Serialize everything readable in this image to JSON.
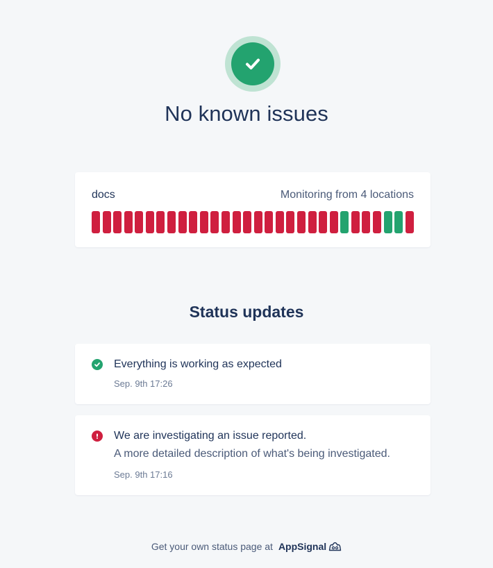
{
  "colors": {
    "up": "#23a36f",
    "down": "#cf1f3f",
    "halo": "#bfe3d3"
  },
  "status": {
    "icon": "check-icon",
    "headline": "No known issues"
  },
  "monitor": {
    "name": "docs",
    "locations_text": "Monitoring from 4 locations",
    "bars": [
      "down",
      "down",
      "down",
      "down",
      "down",
      "down",
      "down",
      "down",
      "down",
      "down",
      "down",
      "down",
      "down",
      "down",
      "down",
      "down",
      "down",
      "down",
      "down",
      "down",
      "down",
      "down",
      "down",
      "up",
      "down",
      "down",
      "down",
      "up",
      "up",
      "down"
    ]
  },
  "updates": {
    "title": "Status updates",
    "items": [
      {
        "icon": "check-circle-icon",
        "title": "Everything is working as expected",
        "description": "",
        "time": "Sep. 9th 17:26"
      },
      {
        "icon": "exclamation-circle-icon",
        "title": "We are investigating an issue reported.",
        "description": "A more detailed description of what's being investigated.",
        "time": "Sep. 9th 17:16"
      }
    ]
  },
  "footer": {
    "text": "Get your own status page at",
    "brand": "AppSignal",
    "brand_icon": "appsignal-logo-icon"
  }
}
